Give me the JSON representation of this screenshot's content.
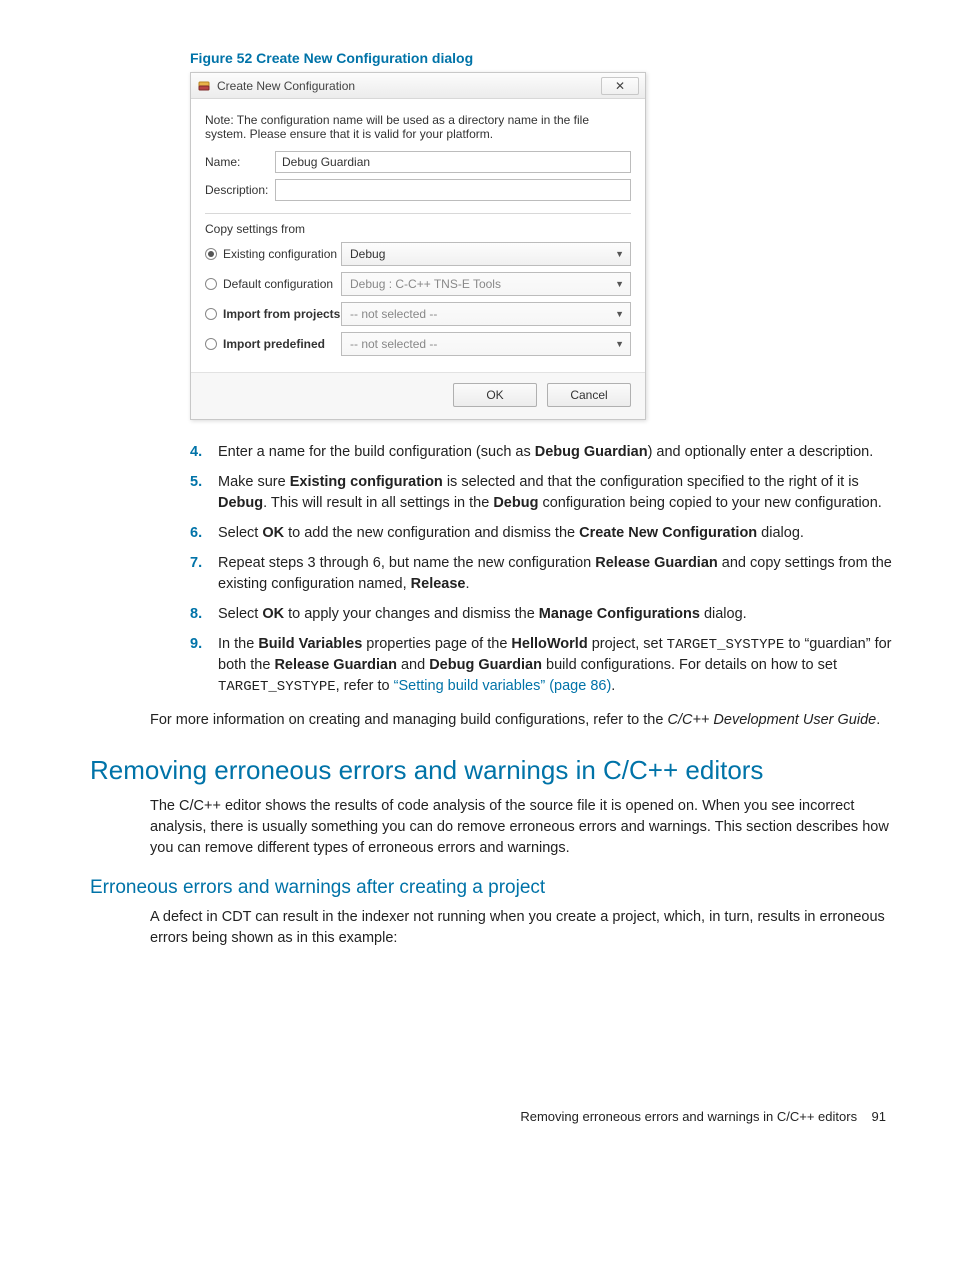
{
  "figure": {
    "caption": "Figure 52 Create New Configuration dialog"
  },
  "dialog": {
    "title": "Create New Configuration",
    "note": "Note: The configuration name will be used as a directory name in the file system.  Please ensure that it is valid for your platform.",
    "name_label": "Name:",
    "name_value": "Debug Guardian",
    "desc_label": "Description:",
    "desc_value": "",
    "copy_label": "Copy settings from",
    "opts": {
      "existing": {
        "label": "Existing configuration",
        "value": "Debug"
      },
      "default": {
        "label": "Default configuration",
        "value": "Debug : C-C++ TNS-E Tools"
      },
      "import_projects": {
        "label": "Import from projects",
        "value": "-- not selected --"
      },
      "import_predefined": {
        "label": "Import predefined",
        "value": "-- not selected --"
      }
    },
    "ok": "OK",
    "cancel": "Cancel"
  },
  "steps": {
    "s4": {
      "num": "4.",
      "a": "Enter a name for the build configuration (such as ",
      "b": "Debug Guardian",
      "c": ") and optionally enter a description."
    },
    "s5": {
      "num": "5.",
      "a": "Make sure ",
      "b": "Existing configuration",
      "c": " is selected and that the configuration specified to the right of it is ",
      "d": "Debug",
      "e": ". This will result in all settings in the ",
      "f": "Debug",
      "g": " configuration being copied to your new configuration."
    },
    "s6": {
      "num": "6.",
      "a": "Select ",
      "b": "OK",
      "c": " to add the new configuration and dismiss the ",
      "d": "Create New Configuration",
      "e": " dialog."
    },
    "s7": {
      "num": "7.",
      "a": "Repeat steps 3 through 6, but name the new configuration ",
      "b": "Release Guardian",
      "c": " and copy settings from the existing configuration named, ",
      "d": "Release",
      "e": "."
    },
    "s8": {
      "num": "8.",
      "a": "Select ",
      "b": "OK",
      "c": " to apply your changes and dismiss the ",
      "d": "Manage Configurations",
      "e": " dialog."
    },
    "s9": {
      "num": "9.",
      "a": "In the ",
      "b": "Build Variables",
      "c": " properties page of the ",
      "d": "HelloWorld",
      "e": " project, set ",
      "f": "TARGET_SYSTYPE",
      "g": " to “guardian” for both the ",
      "h": "Release Guardian",
      "i": " and ",
      "j": "Debug Guardian",
      "k": " build configurations. For details on how to set ",
      "l": "TARGET_SYSTYPE",
      "m": ", refer to ",
      "link": "“Setting build variables” (page 86)",
      "n": "."
    }
  },
  "para_more": {
    "a": "For more information on creating and managing build configurations, refer to the ",
    "b": "C/C++ Development User Guide",
    "c": "."
  },
  "h2": "Removing erroneous errors and warnings in C/C++ editors",
  "para_intro": "The C/C++ editor shows the results of code analysis of the source file it is opened on. When you see incorrect analysis, there is usually something you can do remove erroneous errors and warnings. This section describes how you can remove different types of erroneous errors and warnings.",
  "h3": "Erroneous errors and warnings after creating a project",
  "para_cdt": "A defect in CDT can result in the indexer not running when you create a project, which, in turn, results in erroneous errors being shown as in this example:",
  "footer": {
    "text": "Removing erroneous errors and warnings in C/C++ editors",
    "page": "91"
  }
}
